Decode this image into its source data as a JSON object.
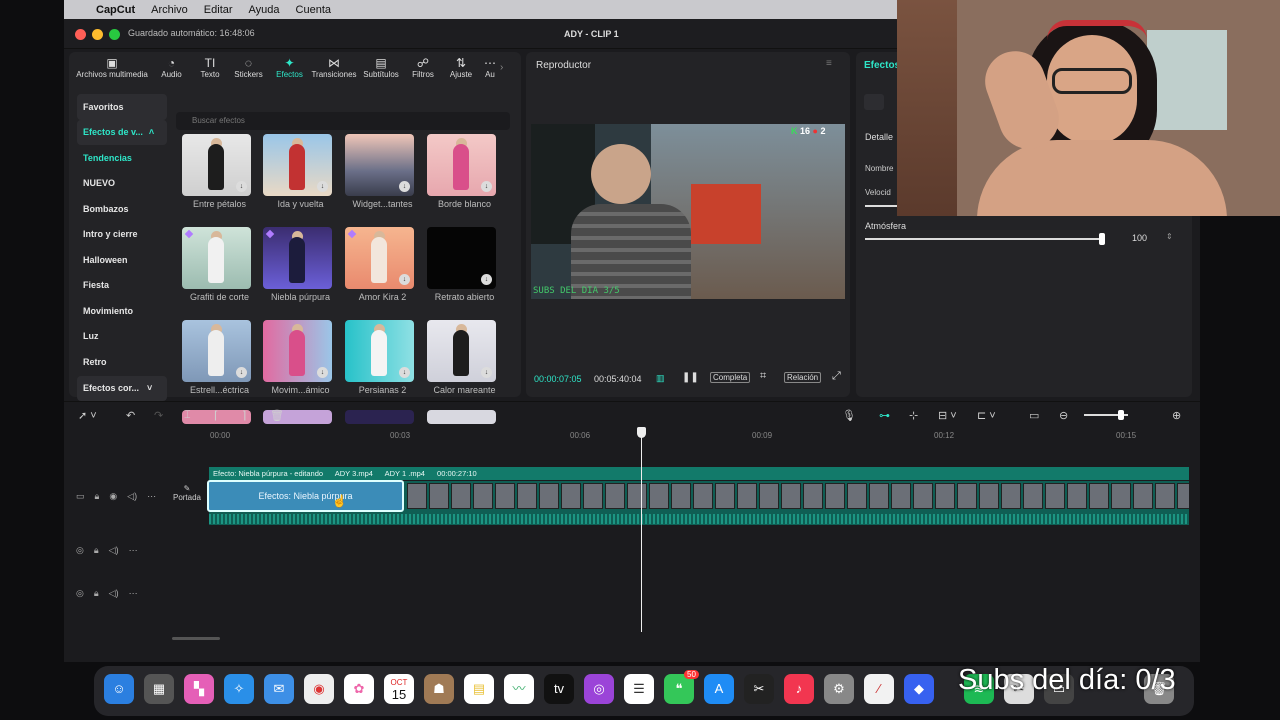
{
  "menubar": {
    "app": "CapCut",
    "items": [
      "Archivo",
      "Editar",
      "Ayuda",
      "Cuenta"
    ]
  },
  "window": {
    "autosave": "Guardado automático: 16:48:06",
    "title": "ADY - CLIP 1"
  },
  "toolbar": {
    "tabs": [
      {
        "icon": "media-icon",
        "label": "Archivos multimedia"
      },
      {
        "icon": "audio-icon",
        "label": "Audio"
      },
      {
        "icon": "text-icon",
        "label": "Texto"
      },
      {
        "icon": "sticker-icon",
        "label": "Stickers"
      },
      {
        "icon": "effects-icon",
        "label": "Efectos"
      },
      {
        "icon": "transition-icon",
        "label": "Transiciones"
      },
      {
        "icon": "subtitle-icon",
        "label": "Subtítulos"
      },
      {
        "icon": "filter-icon",
        "label": "Filtros"
      },
      {
        "icon": "adjust-icon",
        "label": "Ajuste"
      },
      {
        "icon": "more-icon",
        "label": "Au"
      }
    ]
  },
  "sidebar": {
    "categories": [
      {
        "label": "Favoritos"
      },
      {
        "label": "Efectos de v..."
      },
      {
        "label": "Tendencias"
      },
      {
        "label": "NUEVO"
      },
      {
        "label": "Bombazos"
      },
      {
        "label": "Intro y cierre"
      },
      {
        "label": "Halloween"
      },
      {
        "label": "Fiesta"
      },
      {
        "label": "Movimiento"
      },
      {
        "label": "Luz"
      },
      {
        "label": "Retro"
      }
    ],
    "bottom": "Efectos cor..."
  },
  "search": {
    "placeholder": "Buscar efectos"
  },
  "effects": [
    {
      "label": "Entre pétalos"
    },
    {
      "label": "Ida y vuelta"
    },
    {
      "label": "Widget...tantes"
    },
    {
      "label": "Borde blanco"
    },
    {
      "label": "Grafiti de corte"
    },
    {
      "label": "Niebla púrpura"
    },
    {
      "label": "Amor Kira 2"
    },
    {
      "label": "Retrato abierto"
    },
    {
      "label": "Estrell...éctrica"
    },
    {
      "label": "Movim...ámico"
    },
    {
      "label": "Persianas 2"
    },
    {
      "label": "Calor mareante"
    }
  ],
  "player": {
    "title": "Reproductor",
    "current": "00:00:07:05",
    "total": "00:05:40:04",
    "full": "Completa",
    "ratio": "Relación",
    "caption": "SUBS DEL DIA 3/5",
    "score_a": "16",
    "score_b": "2"
  },
  "detail": {
    "tab": "Efectos",
    "section": "Detalle",
    "name_label": "Nombre",
    "speed_label": "Velocid",
    "atmosphere_label": "Atmósfera",
    "atmosphere_value": "100",
    "atmosphere_level": 100
  },
  "timeline": {
    "ticks": [
      "00:00",
      "00:03",
      "00:06",
      "00:09",
      "00:12",
      "00:15"
    ],
    "fx_bar": [
      "Efecto: Niebla púrpura - editando",
      "ADY 3.mp4",
      "ADY 1 .mp4",
      "00:00:27:10"
    ],
    "fx_clip": "Efectos: Niebla púrpura",
    "cover": "Portada"
  },
  "overlay": {
    "text": "Subs del día: 0/3"
  },
  "dock": {
    "calendar_month": "OCT",
    "calendar_day": "15",
    "badge": "50"
  },
  "colors": {
    "accent": "#2ee6c8",
    "clip": "#0f5e54",
    "fx": "#3b8cb8"
  }
}
